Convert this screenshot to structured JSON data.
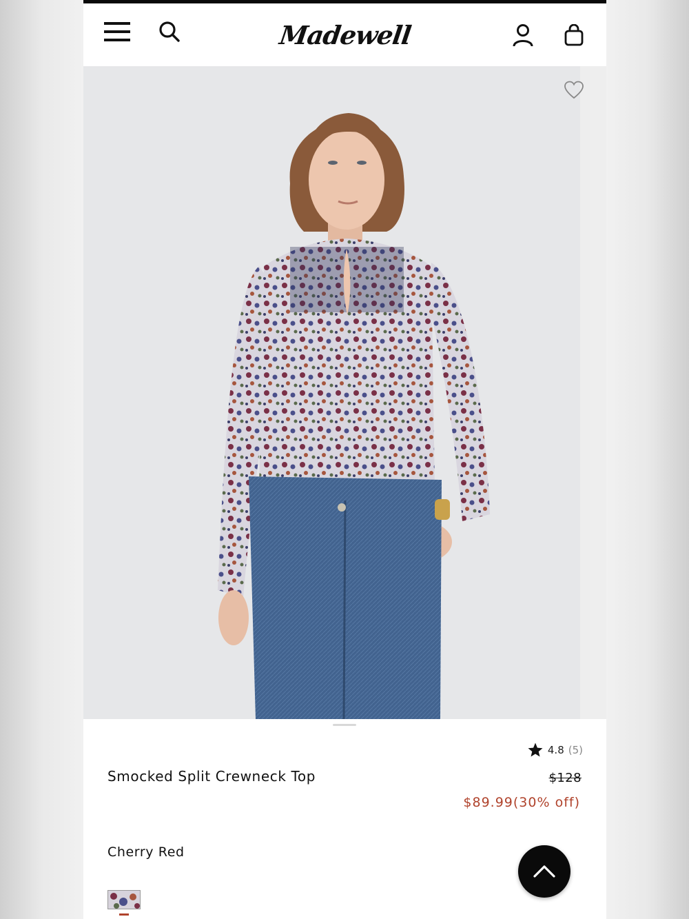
{
  "header": {
    "brand": "Madewell",
    "icons": [
      "menu-icon",
      "search-icon",
      "account-icon",
      "shopping-bag-icon"
    ]
  },
  "product": {
    "image_alt": "Model wearing floral smocked split crewneck top with blue jeans",
    "wishlisted": false,
    "rating": "4.8",
    "review_count": "(5)",
    "title": "Smocked Split Crewneck Top",
    "original_price": "$128",
    "sale_price": "$89.99(30% off)",
    "color_name": "Cherry Red"
  },
  "colors": {
    "accent_sale": "#b0432c",
    "text": "#111111",
    "hero_bg": "#e6e7e9"
  }
}
